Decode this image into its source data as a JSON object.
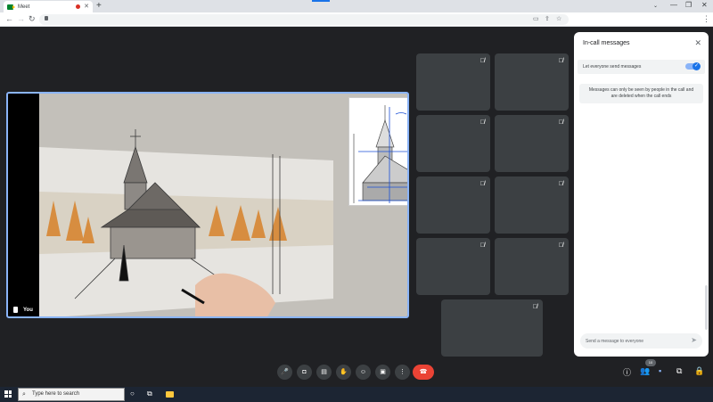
{
  "browser": {
    "tab_title": "Meet",
    "tab_close": "✕",
    "new_tab": "+",
    "minimize": "—",
    "maximize": "❐",
    "close": "✕",
    "back": "←",
    "forward": "→",
    "reload": "↻",
    "menu": "⋮",
    "omnibox_icons": [
      "cast-icon",
      "share-icon",
      "star-icon"
    ]
  },
  "presentation": {
    "owner_label": "You",
    "content": "sketch of a wooden church"
  },
  "participant_tiles": {
    "count": 9,
    "mic_state": "muted"
  },
  "chat_panel": {
    "title": "In-call messages",
    "toggle_label": "Let everyone send messages",
    "toggle_on": true,
    "info_text_line1": "Messages can only be seen by people in the call and",
    "info_text_line2": "are deleted when the call ends",
    "input_placeholder": "Send a message to everyone"
  },
  "controls": {
    "participant_count": "10",
    "accent_color": "#1a73e8",
    "end_call_color": "#ea4335"
  },
  "taskbar": {
    "search_placeholder": "Type here to search"
  }
}
